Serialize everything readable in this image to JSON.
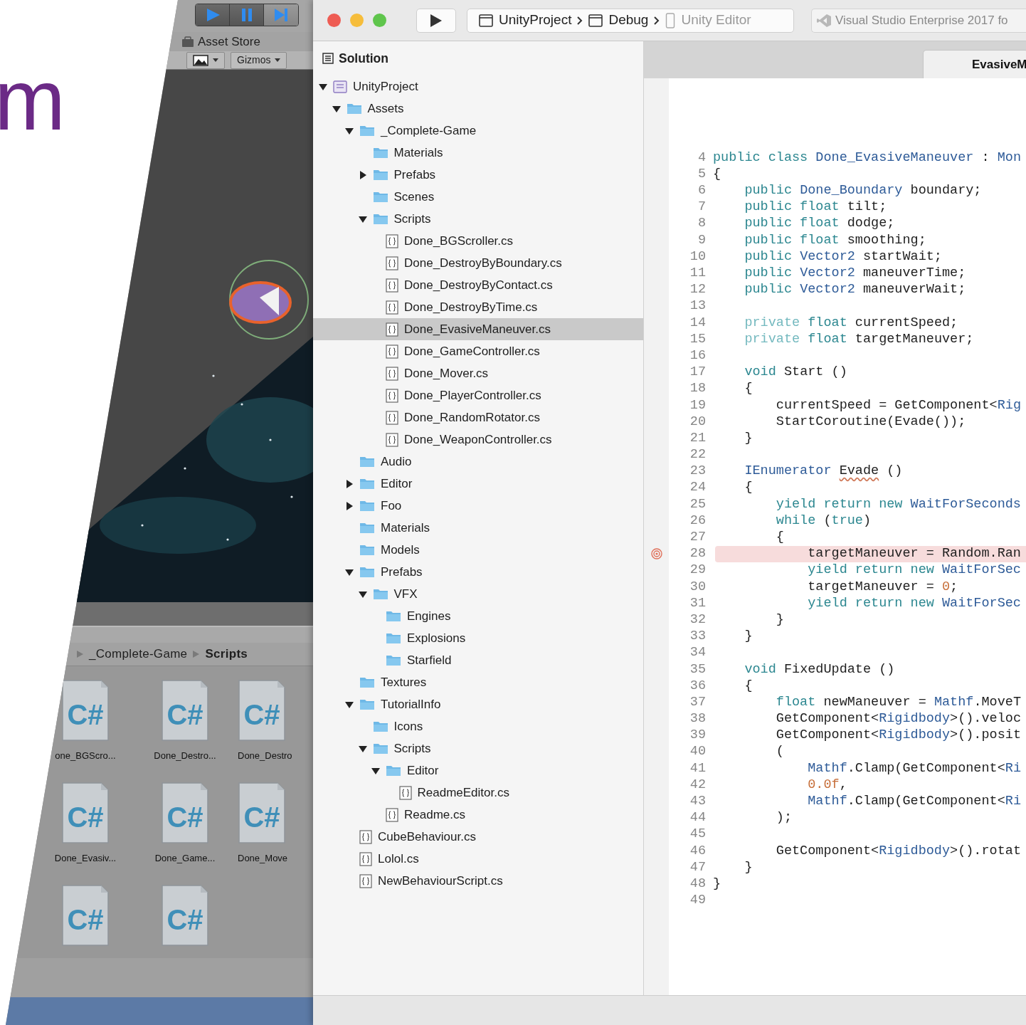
{
  "slide": {
    "text": "m"
  },
  "unity": {
    "play_controls": [
      {
        "kind": "play"
      },
      {
        "kind": "pause"
      },
      {
        "kind": "step"
      }
    ],
    "window_tab": "Asset Store",
    "scene_toolbar": {
      "gizmos": "Gizmos"
    },
    "breadcrumb": [
      {
        "label": "_Complete-Game",
        "current": false
      },
      {
        "label": "Scripts",
        "current": true
      }
    ],
    "assets": [
      {
        "kind": "script",
        "type_label": "C#",
        "label": "one_BGScro..."
      },
      {
        "kind": "script",
        "type_label": "C#",
        "label": "Done_Destro..."
      },
      {
        "kind": "script",
        "type_label": "C#",
        "label": "Done_Destro"
      },
      {
        "kind": "script",
        "type_label": "C#",
        "label": "Done_Evasiv..."
      },
      {
        "kind": "script",
        "type_label": "C#",
        "label": "Done_Game..."
      },
      {
        "kind": "script",
        "type_label": "C#",
        "label": "Done_Move"
      },
      {
        "kind": "script",
        "type_label": "C#"
      },
      {
        "kind": "script",
        "type_label": "C#"
      }
    ]
  },
  "title_bar": {
    "breadcrumb": [
      {
        "kind": "project",
        "label": "UnityProject",
        "disabled": false
      },
      {
        "kind": "config",
        "label": "Debug",
        "disabled": false
      },
      {
        "kind": "device",
        "label": "Unity Editor",
        "disabled": true
      }
    ],
    "status": "Visual Studio Enterprise 2017 fo"
  },
  "solution": {
    "title": "Solution",
    "tree": [
      {
        "kind": "project",
        "label": "UnityProject",
        "selected": false,
        "expanded": true,
        "children": [
          {
            "kind": "folder",
            "label": "Assets",
            "selected": false,
            "expanded": true,
            "children": [
              {
                "kind": "folder",
                "label": "_Complete-Game",
                "selected": false,
                "expanded": true,
                "children": [
                  {
                    "kind": "folder",
                    "label": "Materials",
                    "selected": false
                  },
                  {
                    "kind": "folder",
                    "label": "Prefabs",
                    "selected": false,
                    "expanded": false
                  },
                  {
                    "kind": "folder",
                    "label": "Scenes",
                    "selected": false
                  },
                  {
                    "kind": "folder",
                    "label": "Scripts",
                    "selected": false,
                    "expanded": true,
                    "children": [
                      {
                        "kind": "file",
                        "label": "Done_BGScroller.cs",
                        "selected": false
                      },
                      {
                        "kind": "file",
                        "label": "Done_DestroyByBoundary.cs",
                        "selected": false
                      },
                      {
                        "kind": "file",
                        "label": "Done_DestroyByContact.cs",
                        "selected": false
                      },
                      {
                        "kind": "file",
                        "label": "Done_DestroyByTime.cs",
                        "selected": false
                      },
                      {
                        "kind": "file",
                        "label": "Done_EvasiveManeuver.cs",
                        "selected": true
                      },
                      {
                        "kind": "file",
                        "label": "Done_GameController.cs",
                        "selected": false
                      },
                      {
                        "kind": "file",
                        "label": "Done_Mover.cs",
                        "selected": false
                      },
                      {
                        "kind": "file",
                        "label": "Done_PlayerController.cs",
                        "selected": false
                      },
                      {
                        "kind": "file",
                        "label": "Done_RandomRotator.cs",
                        "selected": false
                      },
                      {
                        "kind": "file",
                        "label": "Done_WeaponController.cs",
                        "selected": false
                      }
                    ]
                  }
                ]
              },
              {
                "kind": "folder",
                "label": "Audio",
                "selected": false
              },
              {
                "kind": "folder",
                "label": "Editor",
                "selected": false,
                "expanded": false
              },
              {
                "kind": "folder",
                "label": "Foo",
                "selected": false,
                "expanded": false
              },
              {
                "kind": "folder",
                "label": "Materials",
                "selected": false
              },
              {
                "kind": "folder",
                "label": "Models",
                "selected": false
              },
              {
                "kind": "folder",
                "label": "Prefabs",
                "selected": false,
                "expanded": true,
                "children": [
                  {
                    "kind": "folder",
                    "label": "VFX",
                    "selected": false,
                    "expanded": true,
                    "children": [
                      {
                        "kind": "folder",
                        "label": "Engines",
                        "selected": false
                      },
                      {
                        "kind": "folder",
                        "label": "Explosions",
                        "selected": false
                      },
                      {
                        "kind": "folder",
                        "label": "Starfield",
                        "selected": false
                      }
                    ]
                  }
                ]
              },
              {
                "kind": "folder",
                "label": "Textures",
                "selected": false
              },
              {
                "kind": "folder",
                "label": "TutorialInfo",
                "selected": false,
                "expanded": true,
                "children": [
                  {
                    "kind": "folder",
                    "label": "Icons",
                    "selected": false
                  },
                  {
                    "kind": "folder",
                    "label": "Scripts",
                    "selected": false,
                    "expanded": true,
                    "children": [
                      {
                        "kind": "folder",
                        "label": "Editor",
                        "selected": false,
                        "expanded": true,
                        "children": [
                          {
                            "kind": "file",
                            "label": "ReadmeEditor.cs",
                            "selected": false
                          }
                        ]
                      },
                      {
                        "kind": "file",
                        "label": "Readme.cs",
                        "selected": false
                      }
                    ]
                  }
                ]
              },
              {
                "kind": "file",
                "label": "CubeBehaviour.cs",
                "selected": false
              },
              {
                "kind": "file",
                "label": "Lolol.cs",
                "selected": false
              },
              {
                "kind": "file",
                "label": "NewBehaviourScript.cs",
                "selected": false
              }
            ]
          }
        ]
      }
    ]
  },
  "editor": {
    "tabs": [
      {
        "label": "EvasiveM"
      }
    ],
    "lines": [
      {
        "number": "4",
        "breakpoint": false,
        "tokens": [
          {
            "kind": "keyword",
            "text": "public class "
          },
          {
            "kind": "type",
            "text": "Done_EvasiveManeuver"
          },
          {
            "kind": "plain",
            "text": " : "
          },
          {
            "kind": "type",
            "text": "Mon"
          }
        ]
      },
      {
        "number": "5",
        "breakpoint": false,
        "tokens": [
          {
            "kind": "plain",
            "text": "{"
          }
        ]
      },
      {
        "number": "6",
        "breakpoint": false,
        "tokens": [
          {
            "kind": "keyword",
            "text": "    public "
          },
          {
            "kind": "type",
            "text": "Done_Boundary"
          },
          {
            "kind": "plain",
            "text": " boundary;"
          }
        ]
      },
      {
        "number": "7",
        "breakpoint": false,
        "tokens": [
          {
            "kind": "keyword",
            "text": "    public float "
          },
          {
            "kind": "plain",
            "text": "tilt;"
          }
        ]
      },
      {
        "number": "8",
        "breakpoint": false,
        "tokens": [
          {
            "kind": "keyword",
            "text": "    public float "
          },
          {
            "kind": "plain",
            "text": "dodge;"
          }
        ]
      },
      {
        "number": "9",
        "breakpoint": false,
        "tokens": [
          {
            "kind": "keyword",
            "text": "    public float "
          },
          {
            "kind": "plain",
            "text": "smoothing;"
          }
        ]
      },
      {
        "number": "10",
        "breakpoint": false,
        "tokens": [
          {
            "kind": "keyword",
            "text": "    public "
          },
          {
            "kind": "type",
            "text": "Vector2"
          },
          {
            "kind": "plain",
            "text": " startWait;"
          }
        ]
      },
      {
        "number": "11",
        "breakpoint": false,
        "tokens": [
          {
            "kind": "keyword",
            "text": "    public "
          },
          {
            "kind": "type",
            "text": "Vector2"
          },
          {
            "kind": "plain",
            "text": " maneuverTime;"
          }
        ]
      },
      {
        "number": "12",
        "breakpoint": false,
        "tokens": [
          {
            "kind": "keyword",
            "text": "    public "
          },
          {
            "kind": "type",
            "text": "Vector2"
          },
          {
            "kind": "plain",
            "text": " maneuverWait;"
          }
        ]
      },
      {
        "number": "13",
        "breakpoint": false
      },
      {
        "number": "14",
        "breakpoint": false,
        "tokens": [
          {
            "kind": "modifier",
            "text": "    private "
          },
          {
            "kind": "keyword",
            "text": "float "
          },
          {
            "kind": "plain",
            "text": "currentSpeed;"
          }
        ]
      },
      {
        "number": "15",
        "breakpoint": false,
        "tokens": [
          {
            "kind": "modifier",
            "text": "    private "
          },
          {
            "kind": "keyword",
            "text": "float "
          },
          {
            "kind": "plain",
            "text": "targetManeuver;"
          }
        ]
      },
      {
        "number": "16",
        "breakpoint": false
      },
      {
        "number": "17",
        "breakpoint": false,
        "tokens": [
          {
            "kind": "keyword",
            "text": "    void "
          },
          {
            "kind": "plain",
            "text": "Start ()"
          }
        ]
      },
      {
        "number": "18",
        "breakpoint": false,
        "tokens": [
          {
            "kind": "plain",
            "text": "    {"
          }
        ]
      },
      {
        "number": "19",
        "breakpoint": false,
        "tokens": [
          {
            "kind": "plain",
            "text": "        currentSpeed = GetComponent<"
          },
          {
            "kind": "type",
            "text": "Rig"
          }
        ]
      },
      {
        "number": "20",
        "breakpoint": false,
        "tokens": [
          {
            "kind": "plain",
            "text": "        StartCoroutine(Evade());"
          }
        ]
      },
      {
        "number": "21",
        "breakpoint": false,
        "tokens": [
          {
            "kind": "plain",
            "text": "    }"
          }
        ]
      },
      {
        "number": "22",
        "breakpoint": false
      },
      {
        "number": "23",
        "breakpoint": false,
        "tokens": [
          {
            "kind": "type",
            "text": "    IEnumerator "
          },
          {
            "kind": "warning",
            "text": "Evade"
          },
          {
            "kind": "plain",
            "text": " ()"
          }
        ]
      },
      {
        "number": "24",
        "breakpoint": false,
        "tokens": [
          {
            "kind": "plain",
            "text": "    {"
          }
        ]
      },
      {
        "number": "25",
        "breakpoint": false,
        "tokens": [
          {
            "kind": "keyword",
            "text": "        yield return new "
          },
          {
            "kind": "type",
            "text": "WaitForSeconds"
          }
        ]
      },
      {
        "number": "26",
        "breakpoint": false,
        "tokens": [
          {
            "kind": "keyword",
            "text": "        while "
          },
          {
            "kind": "plain",
            "text": "("
          },
          {
            "kind": "keyword",
            "text": "true"
          },
          {
            "kind": "plain",
            "text": ")"
          }
        ]
      },
      {
        "number": "27",
        "breakpoint": false,
        "tokens": [
          {
            "kind": "plain",
            "text": "        {"
          }
        ]
      },
      {
        "number": "28",
        "breakpoint": true,
        "tokens": [
          {
            "kind": "plain",
            "text": "            targetManeuver = Random.Ran"
          }
        ]
      },
      {
        "number": "29",
        "breakpoint": false,
        "tokens": [
          {
            "kind": "keyword",
            "text": "            yield return new "
          },
          {
            "kind": "type",
            "text": "WaitForSec"
          }
        ]
      },
      {
        "number": "30",
        "breakpoint": false,
        "tokens": [
          {
            "kind": "plain",
            "text": "            targetManeuver = "
          },
          {
            "kind": "number",
            "text": "0"
          },
          {
            "kind": "plain",
            "text": ";"
          }
        ]
      },
      {
        "number": "31",
        "breakpoint": false,
        "tokens": [
          {
            "kind": "keyword",
            "text": "            yield return new "
          },
          {
            "kind": "type",
            "text": "WaitForSec"
          }
        ]
      },
      {
        "number": "32",
        "breakpoint": false,
        "tokens": [
          {
            "kind": "plain",
            "text": "        }"
          }
        ]
      },
      {
        "number": "33",
        "breakpoint": false,
        "tokens": [
          {
            "kind": "plain",
            "text": "    }"
          }
        ]
      },
      {
        "number": "34",
        "breakpoint": false
      },
      {
        "number": "35",
        "breakpoint": false,
        "tokens": [
          {
            "kind": "keyword",
            "text": "    void "
          },
          {
            "kind": "plain",
            "text": "FixedUpdate ()"
          }
        ]
      },
      {
        "number": "36",
        "breakpoint": false,
        "tokens": [
          {
            "kind": "plain",
            "text": "    {"
          }
        ]
      },
      {
        "number": "37",
        "breakpoint": false,
        "tokens": [
          {
            "kind": "keyword",
            "text": "        float "
          },
          {
            "kind": "plain",
            "text": "newManeuver = "
          },
          {
            "kind": "type",
            "text": "Mathf"
          },
          {
            "kind": "plain",
            "text": ".MoveT"
          }
        ]
      },
      {
        "number": "38",
        "breakpoint": false,
        "tokens": [
          {
            "kind": "plain",
            "text": "        GetComponent<"
          },
          {
            "kind": "type",
            "text": "Rigidbody"
          },
          {
            "kind": "plain",
            "text": ">().veloc"
          }
        ]
      },
      {
        "number": "39",
        "breakpoint": false,
        "tokens": [
          {
            "kind": "plain",
            "text": "        GetComponent<"
          },
          {
            "kind": "type",
            "text": "Rigidbody"
          },
          {
            "kind": "plain",
            "text": ">().posit"
          }
        ]
      },
      {
        "number": "40",
        "breakpoint": false,
        "tokens": [
          {
            "kind": "plain",
            "text": "        ("
          }
        ]
      },
      {
        "number": "41",
        "breakpoint": false,
        "tokens": [
          {
            "kind": "type",
            "text": "            Mathf"
          },
          {
            "kind": "plain",
            "text": ".Clamp(GetComponent<"
          },
          {
            "kind": "type",
            "text": "Ri"
          }
        ]
      },
      {
        "number": "42",
        "breakpoint": false,
        "tokens": [
          {
            "kind": "number",
            "text": "            0.0f"
          },
          {
            "kind": "plain",
            "text": ","
          }
        ]
      },
      {
        "number": "43",
        "breakpoint": false,
        "tokens": [
          {
            "kind": "type",
            "text": "            Mathf"
          },
          {
            "kind": "plain",
            "text": ".Clamp(GetComponent<"
          },
          {
            "kind": "type",
            "text": "Ri"
          }
        ]
      },
      {
        "number": "44",
        "breakpoint": false,
        "tokens": [
          {
            "kind": "plain",
            "text": "        );"
          }
        ]
      },
      {
        "number": "45",
        "breakpoint": false
      },
      {
        "number": "46",
        "breakpoint": false,
        "tokens": [
          {
            "kind": "plain",
            "text": "        GetComponent<"
          },
          {
            "kind": "type",
            "text": "Rigidbody"
          },
          {
            "kind": "plain",
            "text": ">().rotat"
          }
        ]
      },
      {
        "number": "47",
        "breakpoint": false,
        "tokens": [
          {
            "kind": "plain",
            "text": "    }"
          }
        ]
      },
      {
        "number": "48",
        "breakpoint": false,
        "tokens": [
          {
            "kind": "plain",
            "text": "}"
          }
        ]
      },
      {
        "number": "49",
        "breakpoint": false
      }
    ]
  }
}
